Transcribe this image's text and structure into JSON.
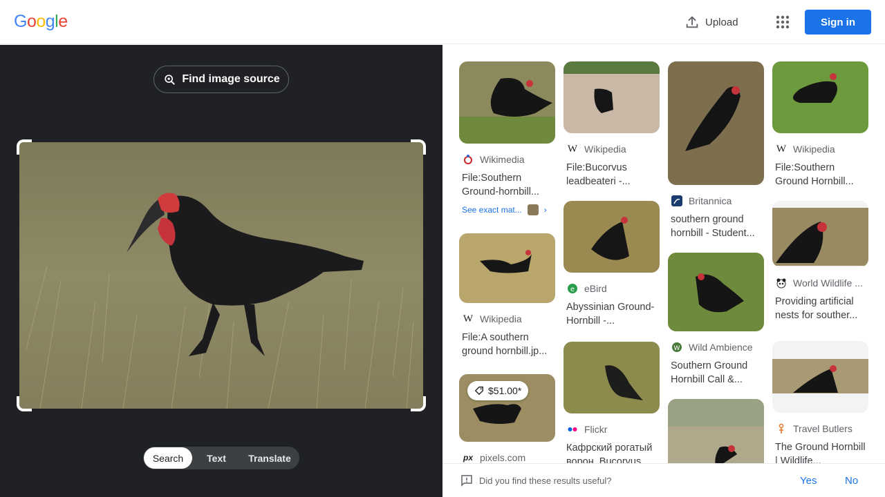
{
  "header": {
    "logo_letters": [
      "G",
      "o",
      "o",
      "g",
      "l",
      "e"
    ],
    "logo_colors": [
      "#4285f4",
      "#ea4335",
      "#fbbc05",
      "#4285f4",
      "#34a853",
      "#ea4335"
    ],
    "upload_label": "Upload",
    "signin_label": "Sign in"
  },
  "left": {
    "find_source_label": "Find image source",
    "modes": [
      {
        "label": "Search",
        "active": true
      },
      {
        "label": "Text",
        "active": false
      },
      {
        "label": "Translate",
        "active": false
      }
    ]
  },
  "results": {
    "col1": [
      {
        "source": "Wikimedia",
        "title": "File:Southern Ground-hornbill...",
        "see_exact": "See exact mat..."
      },
      {
        "source": "Wikipedia",
        "title": "File:A southern ground hornbill.jp..."
      },
      {
        "source": "pixels.com",
        "title": "",
        "price": "$51.00*"
      }
    ],
    "col2": [
      {
        "source": "Wikipedia",
        "title": "File:Bucorvus leadbeateri -..."
      },
      {
        "source": "eBird",
        "title": "Abyssinian Ground-Hornbill -..."
      },
      {
        "source": "Flickr",
        "title": "Кафрский рогатый ворон, Bucorvus..."
      }
    ],
    "col3": [
      {
        "source": "Britannica",
        "title": "southern ground hornbill - Student..."
      },
      {
        "source": "Wild Ambience",
        "title": "Southern Ground Hornbill Call &..."
      },
      {
        "source": "",
        "title": ""
      }
    ],
    "col4": [
      {
        "source": "Wikipedia",
        "title": "File:Southern Ground Hornbill..."
      },
      {
        "source": "World Wildlife ...",
        "title": "Providing artificial nests for souther..."
      },
      {
        "source": "Travel Butlers",
        "title": "The Ground Hornbill | Wildlife..."
      }
    ]
  },
  "feedback": {
    "question": "Did you find these results useful?",
    "yes": "Yes",
    "no": "No"
  },
  "colors": {
    "accent": "#1a73e8",
    "dark_pane": "#202124"
  }
}
